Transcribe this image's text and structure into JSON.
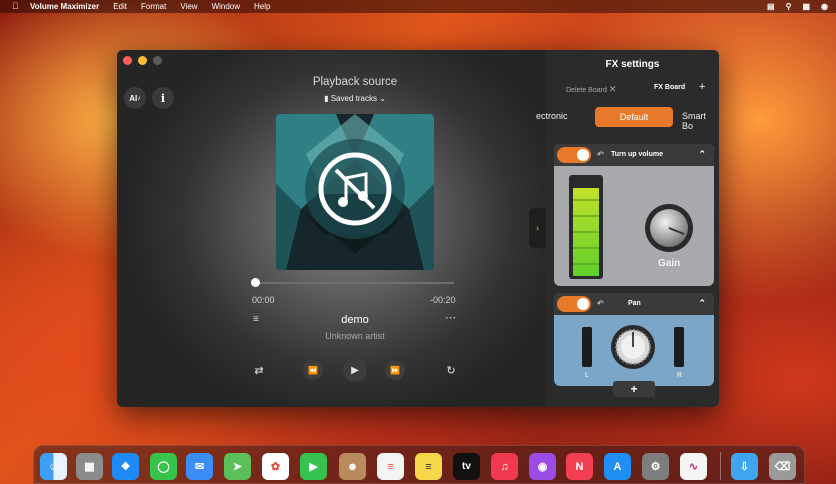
{
  "menubar": {
    "app_name": "Volume Maximizer",
    "items": [
      "Edit",
      "Format",
      "View",
      "Window",
      "Help"
    ]
  },
  "player": {
    "ai_label": "AI",
    "info_label": "i",
    "title": "Playback source",
    "source": "Saved tracks",
    "time_elapsed": "00:00",
    "time_remaining": "-00:20",
    "track_title": "demo",
    "artist": "Unknown artist",
    "progress": 0.0
  },
  "fx": {
    "title": "FX settings",
    "tab_delete": "Delete Board",
    "tab_board": "FX Board",
    "preset_left": "ectronic",
    "preset_selected": "Default",
    "preset_right": "Smart Bo",
    "volume_card": {
      "label": "Turn up volume",
      "knob_label": "Gain",
      "enabled": true
    },
    "pan_card": {
      "label": "Pan",
      "left": "L",
      "right": "R",
      "enabled": true
    },
    "add_label": "+"
  },
  "colors": {
    "accent": "#e8792a",
    "meter_top": "#b8e02a",
    "meter_bottom": "#6fd52a"
  },
  "dock": {
    "apps": [
      "finder-icon",
      "launchpad-icon",
      "safari-icon",
      "messages-icon",
      "mail-icon",
      "maps-icon",
      "photos-icon",
      "facetime-icon",
      "contacts-icon",
      "reminders-icon",
      "notes-icon",
      "tv-icon",
      "music-icon",
      "podcasts-icon",
      "news-icon",
      "app-store-icon",
      "system-settings-icon",
      "volume-maximizer-icon",
      "downloads-icon",
      "trash-icon"
    ],
    "tv_label": "tv"
  }
}
